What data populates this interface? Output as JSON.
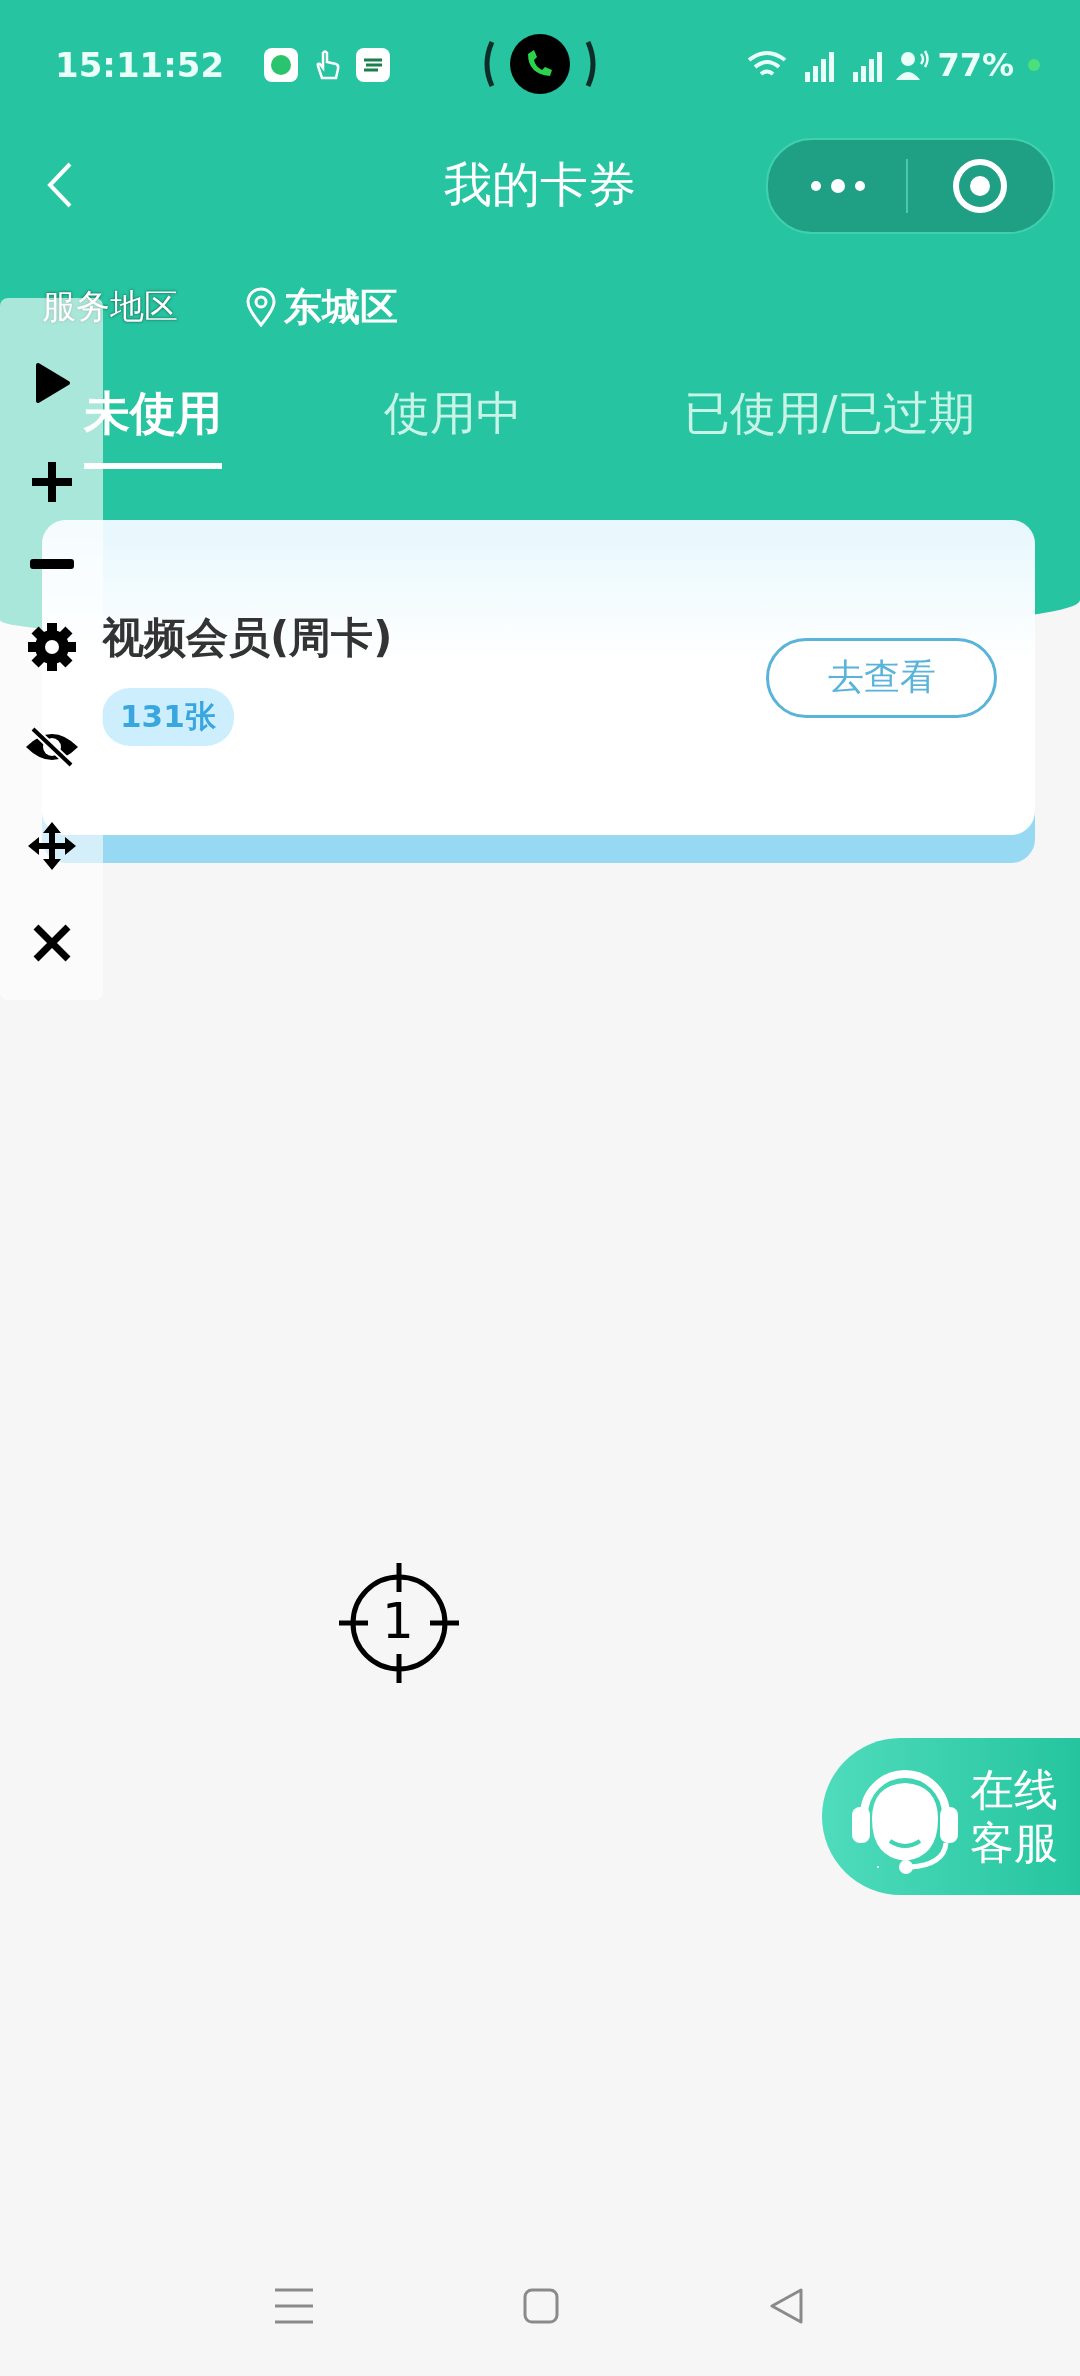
{
  "status_bar": {
    "time": "15:11:52",
    "battery": "77%"
  },
  "nav": {
    "title": "我的卡券"
  },
  "region": {
    "label": "服务地区",
    "value": "东城区"
  },
  "tabs": [
    {
      "label": "未使用",
      "selected": true
    },
    {
      "label": "使用中",
      "selected": false
    },
    {
      "label": "已使用/已过期",
      "selected": false
    }
  ],
  "cards": [
    {
      "title": "视频会员(周卡)",
      "count": "131张",
      "action": "去查看"
    }
  ],
  "marker": {
    "label": "1"
  },
  "service": {
    "lines": [
      "在线",
      "客服"
    ]
  }
}
